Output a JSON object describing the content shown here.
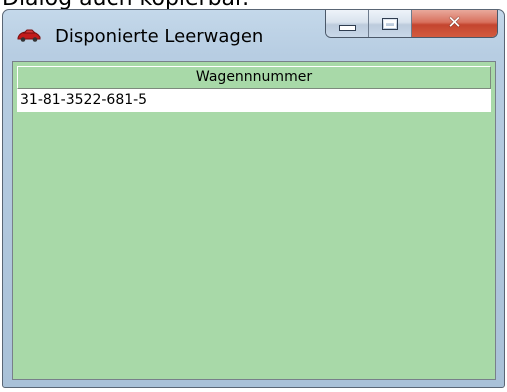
{
  "background_caption": "Dialog auch kopierbar.",
  "window": {
    "title": "Disponierte Leerwagen",
    "icon": "red-car-icon",
    "caption_buttons": {
      "minimize": "minimize-icon",
      "maximize": "maximize-icon",
      "close": "close-icon"
    }
  },
  "grid": {
    "column_header": "Wagennnummer",
    "rows": [
      "31-81-3522-681-5"
    ]
  },
  "colors": {
    "client_bg": "#a8d9a8",
    "close_button": "#c4452f",
    "icon_red": "#c21c1c"
  }
}
